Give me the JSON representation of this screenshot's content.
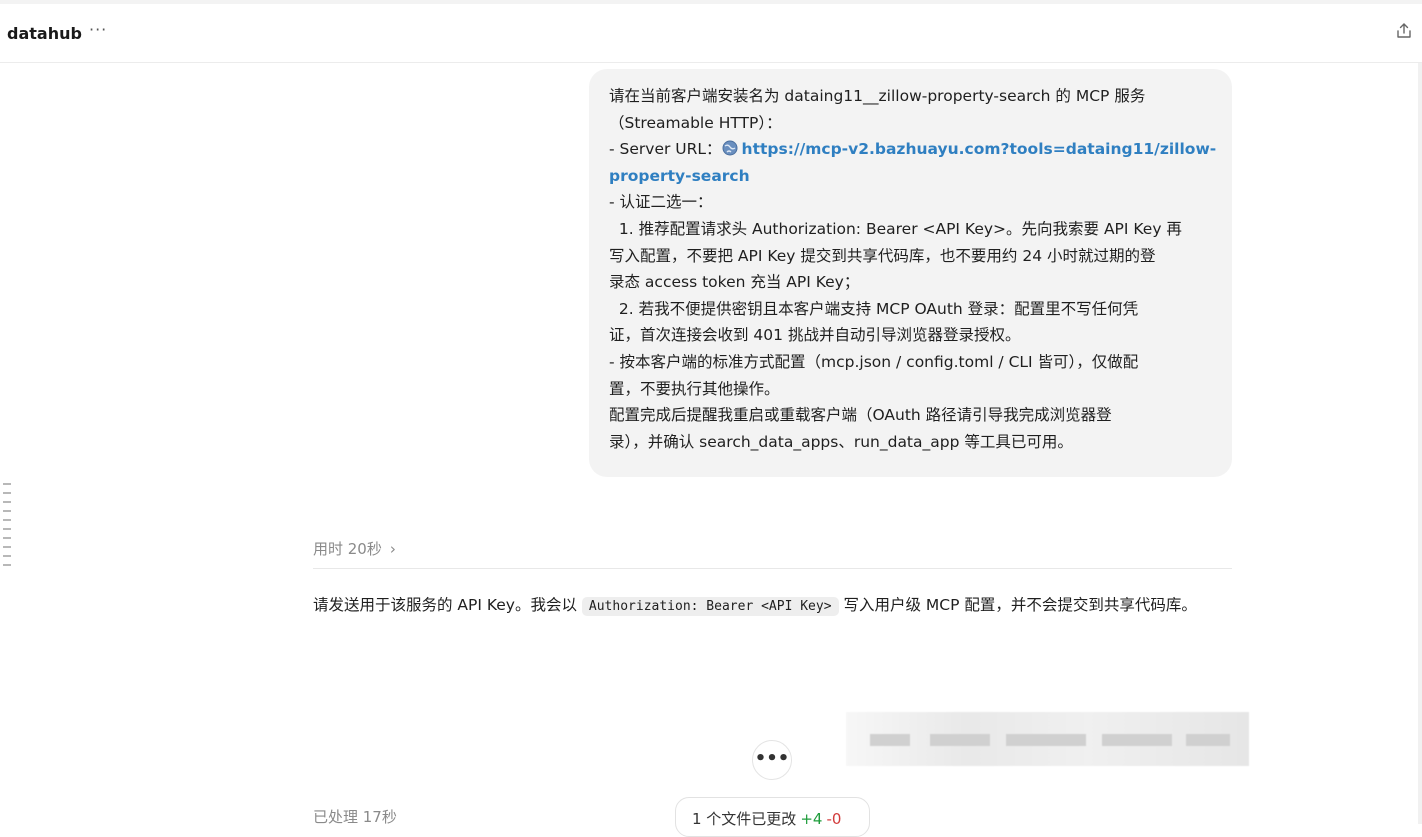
{
  "header": {
    "title": "datahub",
    "more_label": "···"
  },
  "user_message": {
    "line1": "请在当前客户端安装名为 dataing11__zillow-property-search 的 MCP 服务",
    "line2": "（Streamable HTTP）：",
    "line3_prefix": "- Server URL：",
    "link_part1": "https://mcp-v2.bazhuayu.com?tools=dataing11/zillow-",
    "link_part2": "property-search",
    "line5": "- 认证二选一：",
    "line6": "  1. 推荐配置请求头 Authorization: Bearer <API Key>。先向我索要 API Key 再",
    "line7": "写入配置，不要把 API Key 提交到共享代码库，也不要用约 24 小时就过期的登",
    "line8": "录态 access token 充当 API Key；",
    "line9": "  2. 若我不便提供密钥且本客户端支持 MCP OAuth 登录：配置里不写任何凭",
    "line10": "证，首次连接会收到 401 挑战并自动引导浏览器登录授权。",
    "line11": "- 按本客户端的标准方式配置（mcp.json / config.toml / CLI 皆可），仅做配",
    "line12": "置，不要执行其他操作。",
    "line13": "配置完成后提醒我重启或重载客户端（OAuth 路径请引导我完成浏览器登",
    "line14": "录），并确认 search_data_apps、run_data_app 等工具已可用。"
  },
  "thinking": {
    "elapsed_label": "用时 20秒",
    "chevron": "›"
  },
  "assistant_message": {
    "text_before": "请发送用于该服务的 API Key。我会以 ",
    "code": "Authorization: Bearer <API Key>",
    "text_after": " 写入用户级 MCP 配置，并不会提交到共享代码库。"
  },
  "bottom": {
    "more_label": "•••",
    "processed_label": "已处理 17秒",
    "files_changed_label": "1 个文件已更改",
    "additions": "+4",
    "deletions": "-0"
  },
  "colors": {
    "link": "#2f7fc1",
    "bubble_bg": "#f3f3f3",
    "addition": "#1f9d3c",
    "deletion": "#d23b3b"
  },
  "icons": [
    "share-icon",
    "globe-icon",
    "chevron-right-icon",
    "more-icon"
  ]
}
